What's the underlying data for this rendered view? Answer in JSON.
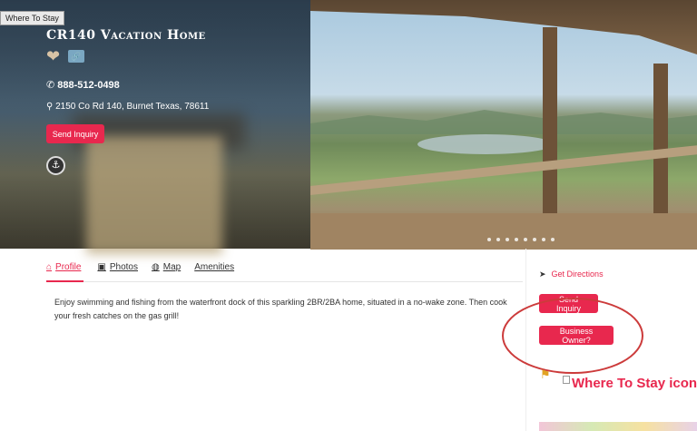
{
  "header": {
    "tooltip": "Where To Stay",
    "title": "CR140 Vacation Home",
    "link_icon": "link-icon",
    "phone_icon": "phone-icon",
    "phone": "888-512-0498",
    "address_icon": "map-marker-icon",
    "address": "2150 Co Rd 140, Burnet Texas, 78611",
    "send_inquiry_label": "Send Inquiry",
    "amenity_icon": "dock-icon"
  },
  "tabs": [
    {
      "label": "Profile",
      "icon": "home-icon",
      "active": true
    },
    {
      "label": "Photos",
      "icon": "image-icon",
      "active": false
    },
    {
      "label": "Map",
      "icon": "globe-icon",
      "active": false
    },
    {
      "label": "Amenities",
      "icon": "",
      "active": false
    }
  ],
  "description": "Enjoy swimming and fishing from the waterfront dock of this sparkling 2BR/2BA home, situated in a no-wake zone. Then cook your fresh catches on the gas grill!",
  "sidebar": {
    "directions_label": "Get Directions",
    "send_inquiry_label": "Send Inquiry",
    "business_owner_label": "Business Owner?",
    "broken_image_alt": "Where To Stay icon"
  },
  "colors": {
    "accent": "#e8284e",
    "annotation_circle": "#cc3b3b"
  }
}
